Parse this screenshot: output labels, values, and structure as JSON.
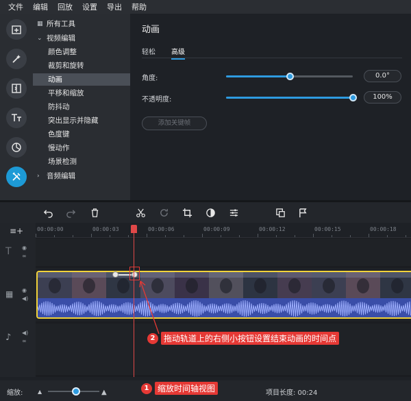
{
  "menubar": {
    "items": [
      "文件",
      "编辑",
      "回放",
      "设置",
      "导出",
      "帮助"
    ]
  },
  "rail": {
    "icons": [
      "import-icon",
      "magic-wand-icon",
      "transitions-icon",
      "titles-icon",
      "stickers-icon",
      "more-tools-icon"
    ],
    "active_index": 5
  },
  "tree": {
    "all_tools": "所有工具",
    "video_editing": "视频编辑",
    "items": [
      "颜色调整",
      "裁剪和旋转",
      "动画",
      "平移和缩放",
      "防抖动",
      "突出显示并隐藏",
      "色度键",
      "慢动作",
      "场景检测"
    ],
    "selected": "动画",
    "audio_editing": "音频编辑"
  },
  "panel": {
    "title": "动画",
    "tabs": [
      "轻松",
      "高级"
    ],
    "active_tab": "高级",
    "angle_label": "角度:",
    "angle_value": "0.0°",
    "angle_fraction": 0.5,
    "opacity_label": "不透明度:",
    "opacity_value": "100%",
    "opacity_fraction": 1.0,
    "add_keyframe": "添加关键帧"
  },
  "toolbar": {
    "icons": [
      "undo-icon",
      "redo-icon",
      "delete-icon",
      "cut-icon",
      "rotate-icon",
      "crop-icon",
      "color-adjust-icon",
      "properties-icon",
      "clip-properties-icon",
      "marker-flag-icon"
    ]
  },
  "timeline": {
    "ticks": [
      "00:00:00",
      "00:00:03",
      "00:00:06",
      "00:00:09",
      "00:00:12",
      "00:00:15",
      "00:00:18"
    ],
    "playhead_time_fraction": 0.263
  },
  "callouts": {
    "c1_num": "1",
    "c1_text": "缩放时间轴视图",
    "c2_num": "2",
    "c2_text": "拖动轨道上的右侧小按钮设置结束动画的时间点"
  },
  "status": {
    "zoom_label": "缩放:",
    "zoom_fraction": 0.55,
    "project_length": "项目长度: 00:24"
  },
  "colors": {
    "accent": "#2e9be0",
    "clip_border": "#f2d33a",
    "playhead": "#e04848",
    "callout": "#e53935"
  }
}
